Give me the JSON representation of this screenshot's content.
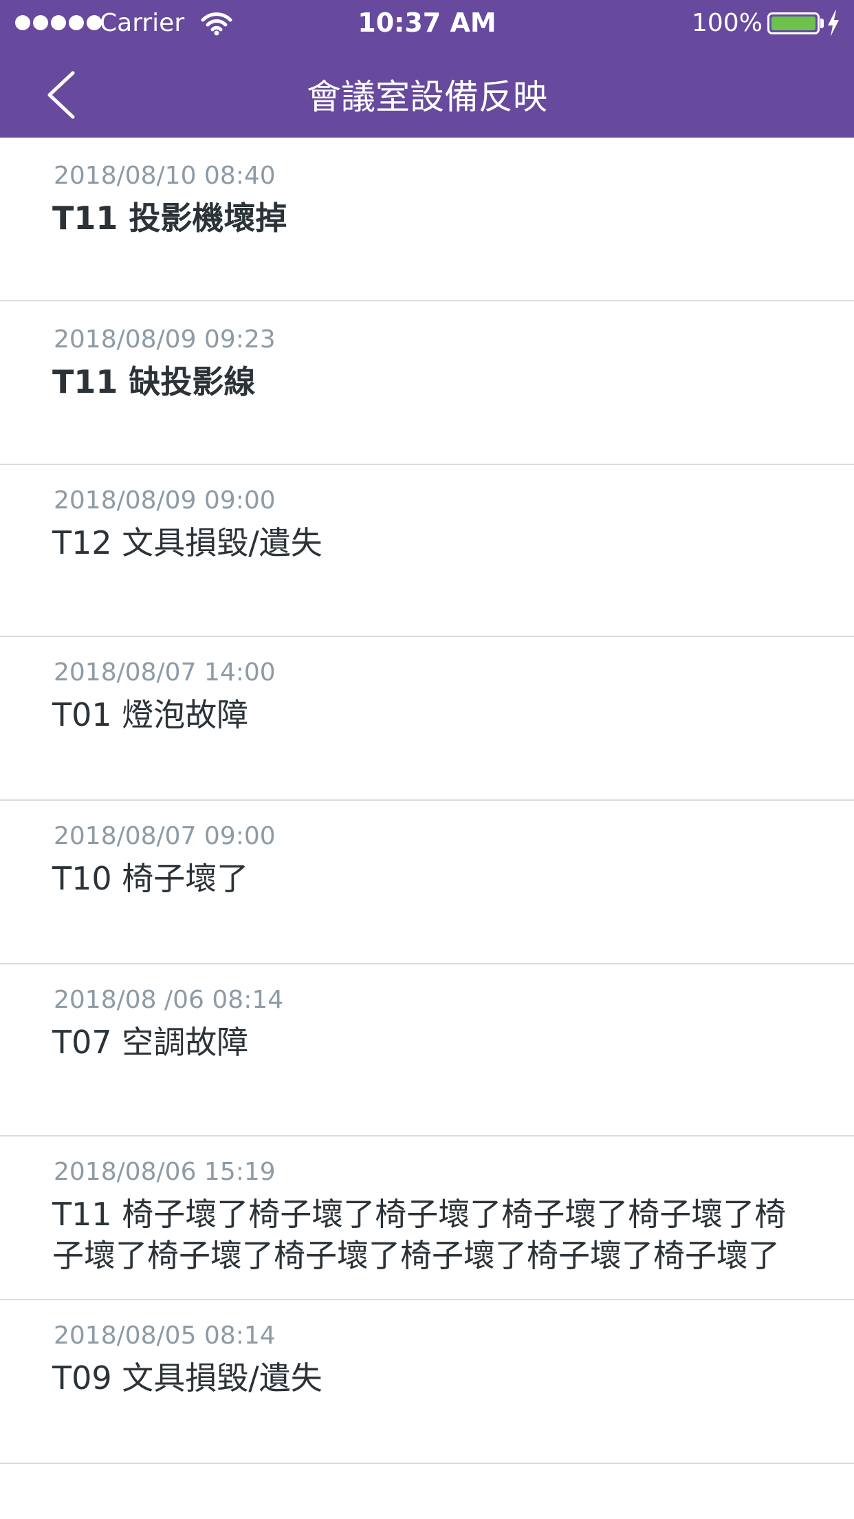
{
  "status_bar": {
    "carrier": "Carrier",
    "time": "10:37 AM",
    "battery_percent": "100%",
    "battery_level": 1.0,
    "battery_color": "#6cc24a"
  },
  "nav": {
    "title": "會議室設備反映",
    "back_icon": "chevron-left-icon",
    "background_color": "#674a9d"
  },
  "reports": [
    {
      "date": "2018/08/10 08:40",
      "text": "T11 投影機壞掉",
      "unread": true
    },
    {
      "date": "2018/08/09 09:23",
      "text": "T11 缺投影線",
      "unread": true
    },
    {
      "date": "2018/08/09 09:00",
      "text": "T12 文具損毀/遺失",
      "unread": false
    },
    {
      "date": "2018/08/07 14:00",
      "text": "T01 燈泡故障",
      "unread": false
    },
    {
      "date": "2018/08/07 09:00",
      "text": "T10 椅子壞了",
      "unread": false
    },
    {
      "date": "2018/08 /06 08:14",
      "text": "T07 空調故障",
      "unread": false
    },
    {
      "date": "2018/08/06 15:19",
      "text": "T11 椅子壞了椅子壞了椅子壞了椅子壞了椅子壞了椅子壞了椅子壞了椅子壞了椅子壞了椅子壞了椅子壞了",
      "unread": false
    },
    {
      "date": "2018/08/05 08:14",
      "text": "T09 文具損毀/遺失",
      "unread": false
    }
  ]
}
